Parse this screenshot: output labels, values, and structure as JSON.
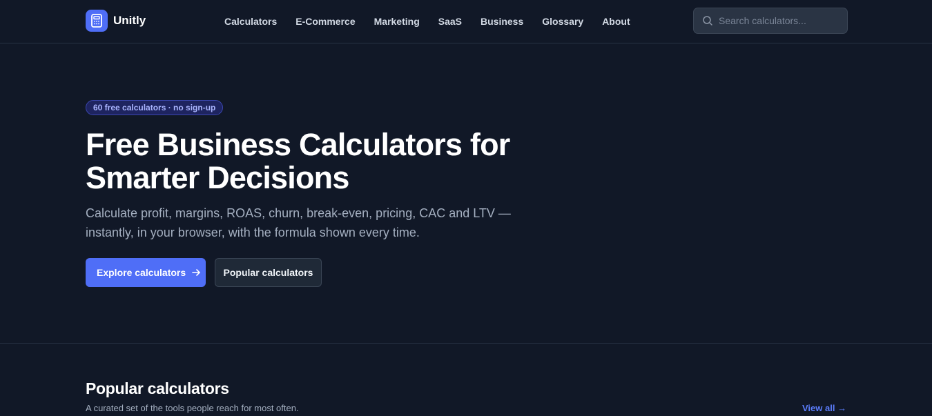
{
  "brand": {
    "name": "Unitly",
    "logo_icon": "calculator-icon",
    "accent": "#4f6ef7"
  },
  "nav": {
    "items": [
      {
        "label": "Calculators"
      },
      {
        "label": "E-Commerce"
      },
      {
        "label": "Marketing"
      },
      {
        "label": "SaaS"
      },
      {
        "label": "Business"
      },
      {
        "label": "Glossary"
      },
      {
        "label": "About"
      }
    ]
  },
  "search": {
    "placeholder": "Search calculators...",
    "value": "",
    "icon": "search-icon"
  },
  "hero": {
    "badge": "60 free calculators · no sign-up",
    "title": "Free Business Calculators for Smarter Decisions",
    "subtitle": "Calculate profit, margins, ROAS, churn, break-even, pricing, CAC and LTV — instantly, in your browser, with the formula shown every time.",
    "primary_button": "Explore calculators",
    "primary_button_icon": "arrow-right-icon",
    "secondary_button": "Popular calculators"
  },
  "popular": {
    "title": "Popular calculators",
    "subtitle": "A curated set of the tools people reach for most often.",
    "view_all": "View all →"
  },
  "colors": {
    "background": "#111827",
    "primary": "#4f6ef7",
    "link": "#5b7cfa",
    "badge_bg": "#1e2460",
    "badge_text": "#aab5ff"
  }
}
